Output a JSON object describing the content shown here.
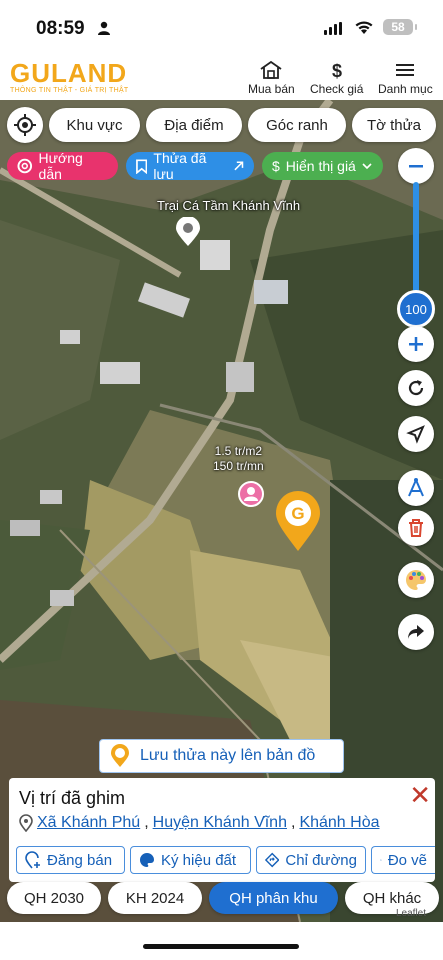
{
  "status": {
    "time": "08:59",
    "battery": "58"
  },
  "header": {
    "logo": "GULAND",
    "tagline": "THÔNG TIN THẬT - GIÁ TRỊ THẬT",
    "nav": {
      "buy_sell": "Mua bán",
      "check_price": "Check giá",
      "menu": "Danh mục"
    }
  },
  "filters": {
    "area": "Khu vực",
    "place": "Địa điểm",
    "corner": "Góc ranh",
    "sheet": "Tờ thửa"
  },
  "pills": {
    "guide": "Hướng dẫn",
    "saved": "Thửa đã lưu",
    "show_price": "Hiển thị giá"
  },
  "zoom": {
    "level": "100"
  },
  "map": {
    "place_name": "Trại Cá Tầm Khánh Vĩnh",
    "price_line1": "1.5 tr/m2",
    "price_line2": "150 tr/mn"
  },
  "save_banner": "Lưu thửa này lên bản đồ",
  "info": {
    "title": "Vị trí đã ghim",
    "ward": "Xã Khánh Phú",
    "district": "Huyện Khánh Vĩnh",
    "province": "Khánh Hòa",
    "actions": {
      "post": "Đăng bán",
      "symbol": "Ký hiệu đất",
      "directions": "Chỉ đường",
      "measure": "Đo vẽ"
    }
  },
  "tabs": {
    "qh2030": "QH 2030",
    "kh2024": "KH 2024",
    "qh_zone": "QH phân khu",
    "qh_other": "QH khác"
  },
  "attribution": "Leaflet",
  "colors": {
    "brand": "#f2a71b",
    "primary": "#1f6fd0",
    "guide_pill": "#e8336d",
    "saved_pill": "#2e8fe6",
    "price_pill": "#4caf50"
  }
}
